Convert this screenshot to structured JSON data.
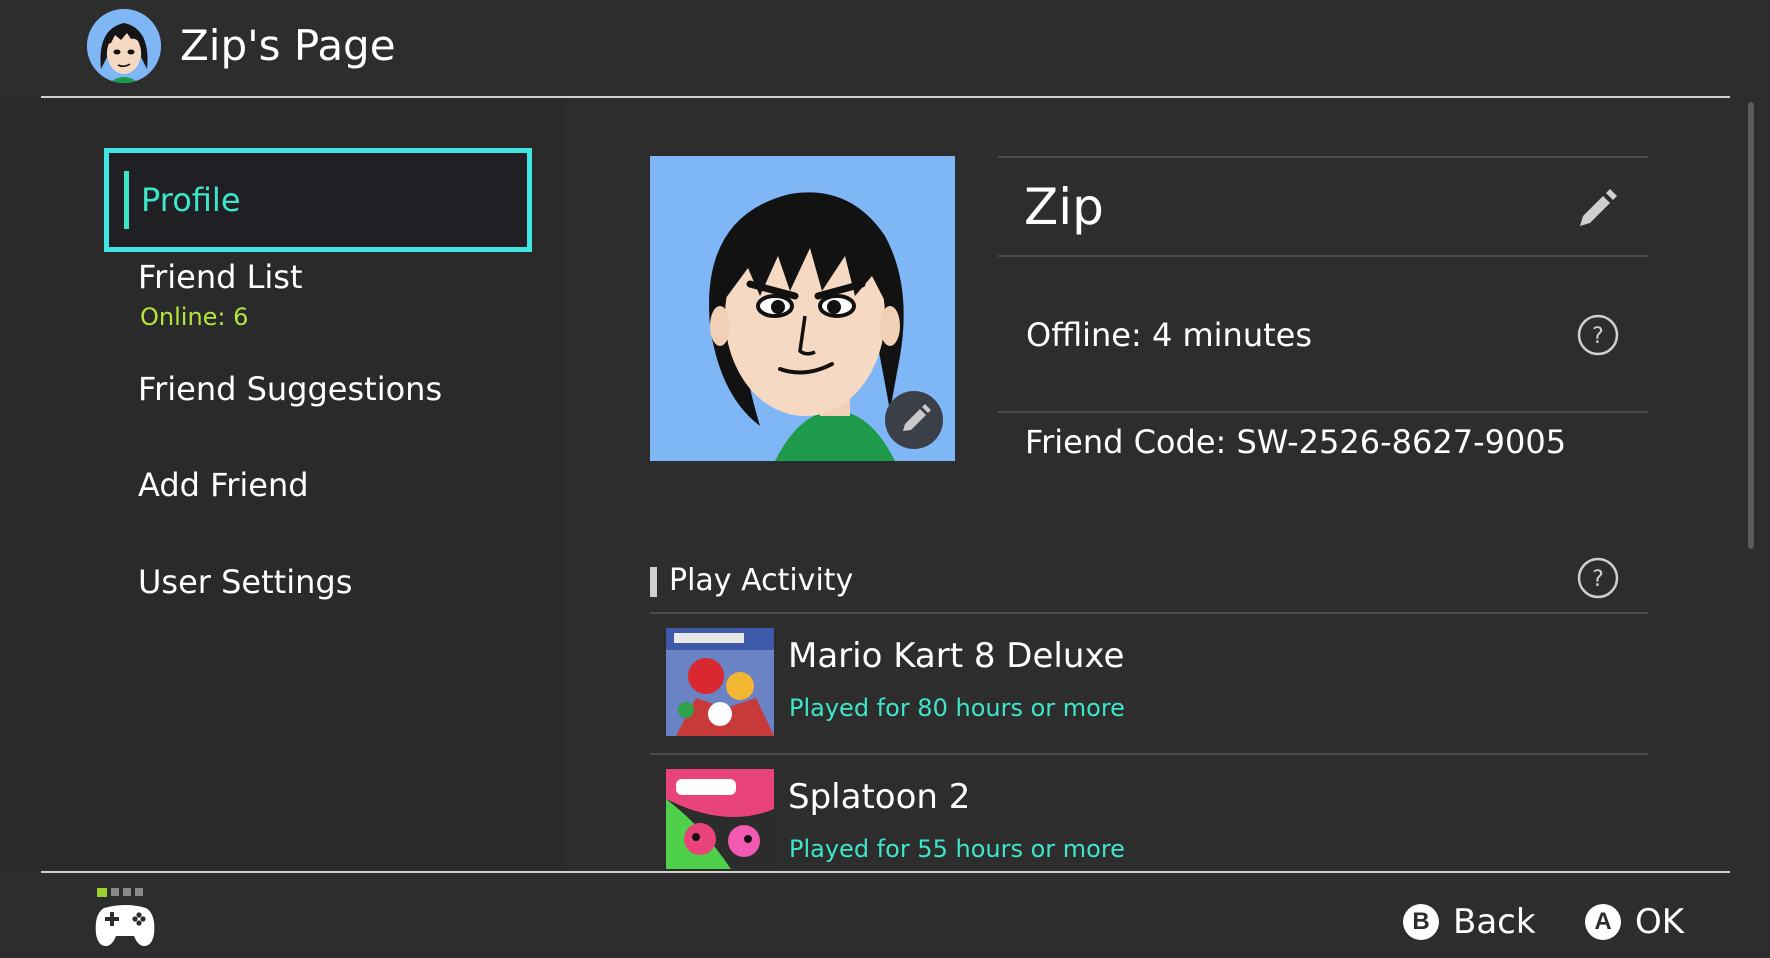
{
  "header": {
    "title": "Zip's Page"
  },
  "sidebar": {
    "items": [
      {
        "label": "Profile",
        "selected": true
      },
      {
        "label": "Friend List",
        "sublabel": "Online: 6"
      },
      {
        "label": "Friend Suggestions"
      },
      {
        "label": "Add Friend"
      },
      {
        "label": "User Settings"
      }
    ]
  },
  "profile": {
    "name": "Zip",
    "status": "Offline: 4 minutes",
    "friend_code": "Friend Code: SW-2526-8627-9005"
  },
  "play_activity": {
    "title": "Play Activity",
    "games": [
      {
        "title": "Mario Kart 8 Deluxe",
        "playtime": "Played for 80 hours or more"
      },
      {
        "title": "Splatoon 2",
        "playtime": "Played for 55 hours or more"
      }
    ]
  },
  "footer": {
    "back_key": "B",
    "back_label": "Back",
    "ok_key": "A",
    "ok_label": "OK"
  },
  "colors": {
    "accent": "#3ee6c9",
    "selection_border": "#40e6e3",
    "online_green": "#b4e53b",
    "background": "#2d2d2d",
    "avatar_bg": "#7fb6f5"
  },
  "icons": {
    "help": "question-circle-icon",
    "edit": "pencil-icon",
    "controller": "gamepad-icon"
  }
}
